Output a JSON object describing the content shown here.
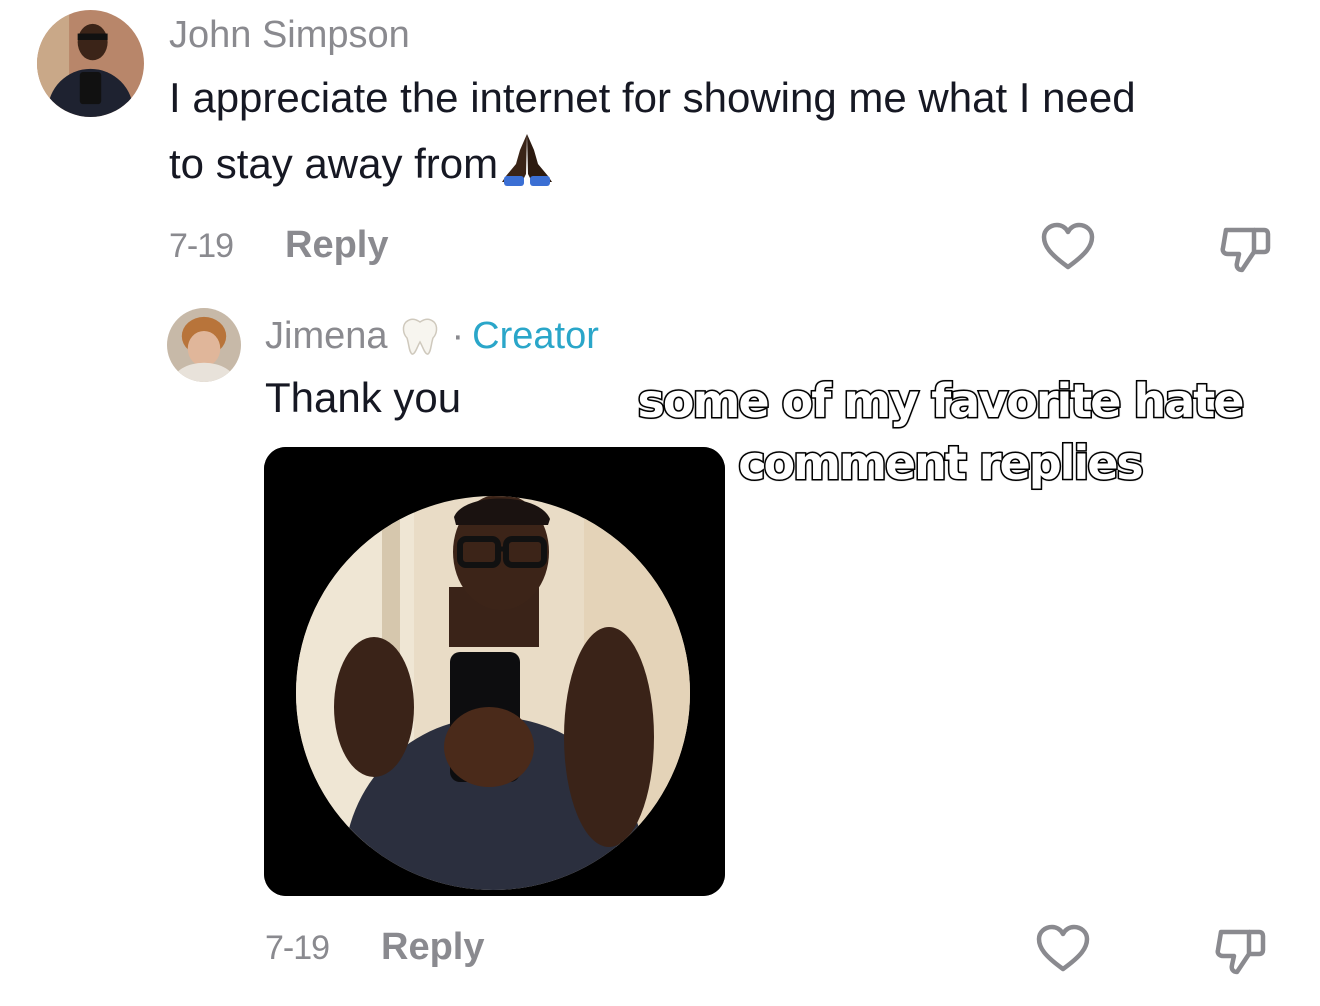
{
  "comment": {
    "username": "John Simpson",
    "text_line1": "I appreciate the internet for showing me what I need",
    "text_line2": "to stay away from",
    "emoji": "praying-hands",
    "date": "7-19",
    "reply_label": "Reply"
  },
  "reply": {
    "username": "Jimena",
    "separator": "·",
    "badge": "Creator",
    "text": "Thank you",
    "date": "7-19",
    "reply_label": "Reply"
  },
  "overlay": {
    "line1": "some of my favorite hate",
    "line2": "comment replies"
  },
  "colors": {
    "text": "#161823",
    "muted": "#8a8a8f",
    "creator": "#2aa6c9",
    "background": "#ffffff"
  }
}
